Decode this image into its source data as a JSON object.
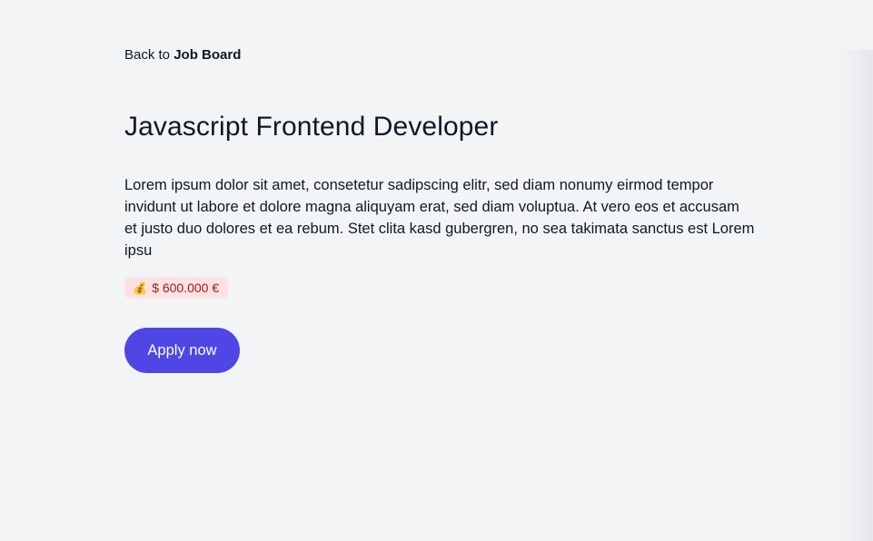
{
  "back_link": {
    "prefix": "Back to",
    "target": "Job Board"
  },
  "job": {
    "title": "Javascript Frontend Developer",
    "description": "Lorem ipsum dolor sit amet, consetetur sadipscing elitr, sed diam nonumy eirmod tempor invidunt ut labore et dolore magna aliquyam erat, sed diam voluptua. At vero eos et accusam et justo duo dolores et ea rebum. Stet clita kasd gubergren, no sea takimata sanctus est Lorem ipsu",
    "salary": {
      "icon": "money-bag-icon",
      "text": "$ 600.000 €"
    }
  },
  "actions": {
    "apply_label": "Apply now"
  },
  "colors": {
    "background": "#f3f4f6",
    "accent": "#4f46e5",
    "badge_background": "#fee2e2",
    "badge_text": "#991b1b"
  }
}
